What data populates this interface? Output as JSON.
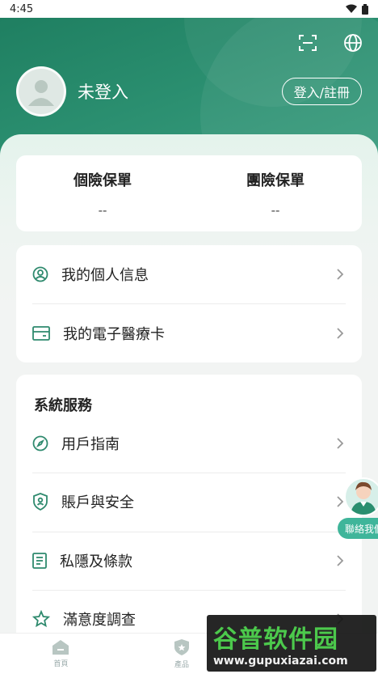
{
  "status_bar": {
    "time": "4:45"
  },
  "header": {
    "username": "未登入",
    "login_button": "登入/註冊"
  },
  "policies": [
    {
      "title": "個險保單",
      "value": "--"
    },
    {
      "title": "團險保單",
      "value": "--"
    }
  ],
  "menu_group1": [
    {
      "label": "我的個人信息",
      "icon": "user-circle-icon"
    },
    {
      "label": "我的電子醫療卡",
      "icon": "card-icon"
    }
  ],
  "services": {
    "title": "系統服務",
    "items": [
      {
        "label": "用戶指南",
        "icon": "compass-icon"
      },
      {
        "label": "賬戶與安全",
        "icon": "shield-user-icon"
      },
      {
        "label": "私隱及條款",
        "icon": "document-icon"
      },
      {
        "label": "滿意度調查",
        "icon": "star-icon"
      }
    ]
  },
  "contact_float": {
    "label": "聯絡我們"
  },
  "bottom_nav": [
    {
      "label": "首頁",
      "icon": "home-icon"
    },
    {
      "label": "產品",
      "icon": "product-shield-icon"
    }
  ],
  "watermark": {
    "title": "谷普软件园",
    "url": "www.gupuxiazai.com"
  },
  "colors": {
    "brand_green": "#2a8e6f",
    "icon_green": "#2f8a6e",
    "contact_green": "#3fb59a"
  }
}
